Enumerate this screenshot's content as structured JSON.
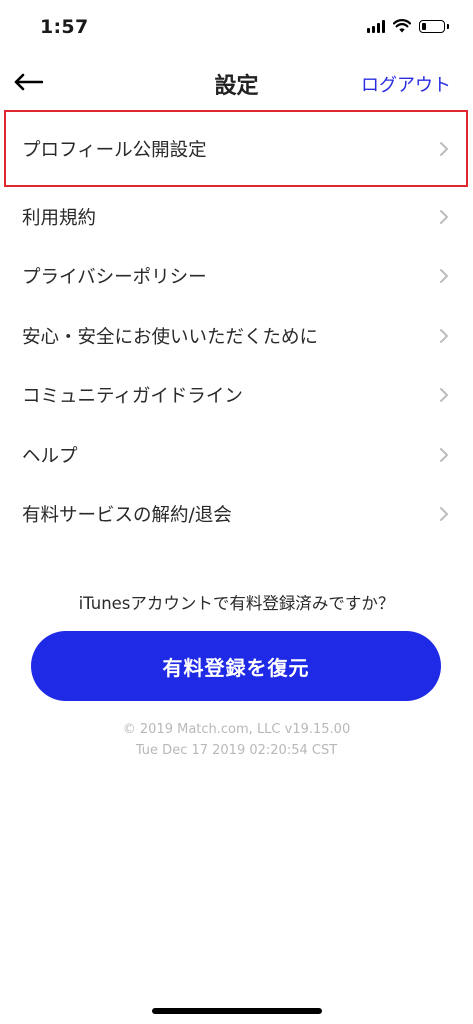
{
  "status_bar": {
    "time": "1:57",
    "signal_icon": "cellular-signal-icon",
    "wifi_icon": "wifi-icon",
    "battery_icon": "battery-icon",
    "battery_level": 0.2
  },
  "nav": {
    "back_icon": "arrow-left-icon",
    "title": "設定",
    "logout_label": "ログアウト"
  },
  "menu": {
    "items": [
      {
        "label": "プロフィール公開設定"
      },
      {
        "label": "利用規約"
      },
      {
        "label": "プライバシーポリシー"
      },
      {
        "label": "安心・安全にお使いいただくために"
      },
      {
        "label": "コミュニティガイドライン"
      },
      {
        "label": "ヘルプ"
      },
      {
        "label": "有料サービスの解約/退会"
      }
    ],
    "chevron_icon": "chevron-right-icon"
  },
  "restore": {
    "question": "iTunesアカウントで有料登録済みですか？",
    "button_label": "有料登録を復元"
  },
  "footer": {
    "copyright": "© 2019 Match.com, LLC v19.15.00",
    "timestamp": "Tue Dec 17 2019 02:20:54 CST"
  },
  "colors": {
    "accent": "#1f2ae6",
    "link": "#2a2ee0",
    "highlight_border": "#e0262e",
    "footer_text": "#b8b8b8"
  }
}
